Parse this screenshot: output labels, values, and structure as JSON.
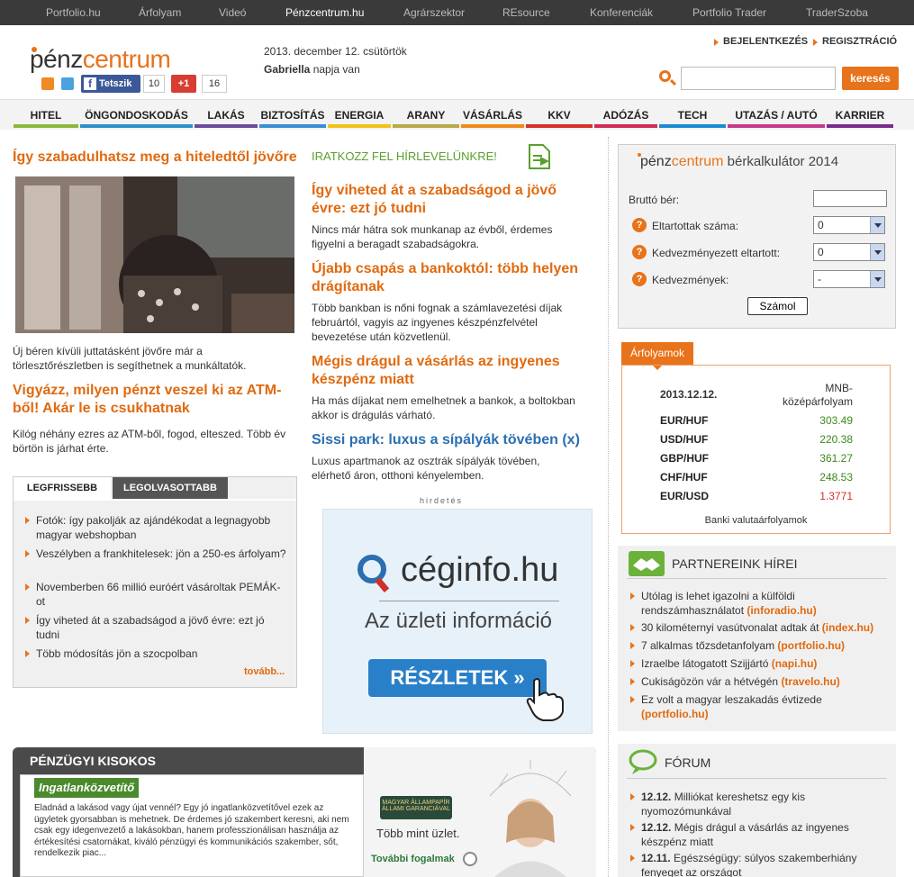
{
  "topnav": [
    "Portfolio.hu",
    "Árfolyam",
    "Videó",
    "Pénzcentrum.hu",
    "Agrárszektor",
    "REsource",
    "Konferenciák",
    "Portfolio Trader",
    "TraderSzoba"
  ],
  "header": {
    "logo_part1": "pénz",
    "logo_part2": "centrum",
    "fb_label": "Tetszik",
    "fb_count": "10",
    "gplus_label": "+1",
    "gplus_count": "16",
    "date": "2013. december 12. csütörtök",
    "nameday_name": "Gabriella",
    "nameday_suffix": " napja van",
    "login": "BEJELENTKEZÉS",
    "register": "REGISZTRÁCIÓ",
    "search_button": "keresés"
  },
  "colors": {
    "accent": "#e8731b"
  },
  "mainnav": [
    {
      "label": "HITEL",
      "color": "#8cb83a"
    },
    {
      "label": "ÖNGONDOSKODÁS",
      "color": "#2e8fc9"
    },
    {
      "label": "LAKÁS",
      "color": "#6c4a9c"
    },
    {
      "label": "BIZTOSÍTÁS",
      "color": "#3a8ed6"
    },
    {
      "label": "ENERGIA",
      "color": "#f3c21a"
    },
    {
      "label": "ARANY",
      "color": "#b9a84a"
    },
    {
      "label": "VÁSÁRLÁS",
      "color": "#ef8a1a"
    },
    {
      "label": "KKV",
      "color": "#d6312a"
    },
    {
      "label": "ADÓZÁS",
      "color": "#d02a5a"
    },
    {
      "label": "TECH",
      "color": "#1a8ad0"
    },
    {
      "label": "UTAZÁS / AUTÓ",
      "color": "#c43a8c"
    },
    {
      "label": "KARRIER",
      "color": "#7a2a8c"
    }
  ],
  "lead": {
    "title": "Így szabadulhatsz meg a hiteledtől jövőre",
    "text": "Új béren kívüli juttatásként jövőre már a törlesztőrészletben is segíthetnek a munkáltatók."
  },
  "article2": {
    "title": "Vigyázz, milyen pénzt veszel ki az ATM-ből! Akár le is csukhatnak",
    "text": "Kilóg néhány ezres az ATM-ből, fogod, elteszed. Több év börtön is járhat érte."
  },
  "tabs": {
    "tab1": "LEGFRISSEBB",
    "tab2": "LEGOLVASOTTABB",
    "items": [
      "Fotók: így pakolják az ajándékodat a legnagyobb magyar webshopban",
      "Veszélyben a frankhitelesek: jön a 250-es árfolyam?",
      "Novemberben 66 millió euróért vásároltak PEMÁK-ot",
      "Így viheted át a szabadságod a jövő évre: ezt jó tudni",
      "Több módosítás jön a szocpolban"
    ],
    "more": "tovább..."
  },
  "middle": {
    "newsletter": "IRATKOZZ FEL HÍRLEVELÜNKRE!",
    "articles": [
      {
        "title": "Így viheted át a szabadságod a jövő évre: ezt jó tudni",
        "text": "Nincs már hátra sok munkanap az évből, érdemes figyelni a beragadt szabadságokra."
      },
      {
        "title": "Újabb csapás a bankoktól: több helyen drágítanak",
        "text": "Több bankban is nőni fognak a számlavezetési díjak februártól, vagyis az ingyenes készpénzfelvétel bevezetése után közvetlenül."
      },
      {
        "title": "Mégis drágul a vásárlás az ingyenes készpénz miatt",
        "text": "Ha más díjakat nem emelhetnek a bankok, a boltokban akkor is drágulás várható."
      },
      {
        "title": "Sissi park: luxus a sípályák tövében (x)",
        "text": "Luxus apartmanok az osztrák sípályák tövében, elérhető áron, otthoni kényelemben."
      }
    ],
    "ad_label": "hirdetés",
    "ad_brand": "céginfo.hu",
    "ad_tagline": "Az üzleti információ",
    "ad_button": "RÉSZLETEK »"
  },
  "kisokos": {
    "title": "PÉNZÜGYI KISOKOS",
    "subtitle": "Ingatlanközvetítő",
    "text": "Eladnád a lakásod vagy újat vennél? Egy jó ingatlanközvetítővel ezek az ügyletek gyorsabban is mehetnek. De érdemes jó szakembert keresni, aki nem csak egy idegenvezető a lakásokban, hanem professzionálisan használja az értékesítési csatornákat, kiváló pénzügyi és kommunikációs szakember, sőt, rendelkezik piac...",
    "badge": "MAGYAR ÁLLAMPAPÍR",
    "badge_sub": "ÁLLAMI GARANCIÁVAL",
    "slogan": "Több mint üzlet.",
    "more": "További fogalmak"
  },
  "calc": {
    "logo_part1": "pénz",
    "logo_part2": "centrum",
    "title": " bérkalkulátor 2014",
    "brutto_label": "Bruttó bér:",
    "rows": [
      {
        "label": "Eltartottak száma:",
        "value": "0"
      },
      {
        "label": "Kedvezményezett eltartott:",
        "value": "0"
      },
      {
        "label": "Kedvezmények:",
        "value": "-"
      }
    ],
    "button": "Számol"
  },
  "fx": {
    "tab": "Árfolyamok",
    "date": "2013.12.12.",
    "header1": "MNB-",
    "header2": "középárfolyam",
    "rows": [
      {
        "pair": "EUR/HUF",
        "value": "303.49",
        "color": "#3a8a1a"
      },
      {
        "pair": "USD/HUF",
        "value": "220.38",
        "color": "#3a8a1a"
      },
      {
        "pair": "GBP/HUF",
        "value": "361.27",
        "color": "#3a8a1a"
      },
      {
        "pair": "CHF/HUF",
        "value": "248.53",
        "color": "#3a8a1a"
      },
      {
        "pair": "EUR/USD",
        "value": "1.3771",
        "color": "#d0302a"
      }
    ],
    "footer": "Banki valutaárfolyamok"
  },
  "partners": {
    "title": "PARTNEREINK HÍREI",
    "items": [
      {
        "text": "Utólag is lehet igazolni a külföldi rendszámhasználatot ",
        "src": "(inforadio.hu)"
      },
      {
        "text": "30 kilométernyi vasútvonalat adtak át ",
        "src": "(index.hu)"
      },
      {
        "text": "7 alkalmas tőzsdetanfolyam ",
        "src": "(portfolio.hu)"
      },
      {
        "text": "Izraelbe látogatott Szijjártó ",
        "src": "(napi.hu)"
      },
      {
        "text": "Cukiságözön vár a hétvégén ",
        "src": "(travelo.hu)"
      },
      {
        "text": "Ez volt a magyar leszakadás évtizede ",
        "src": "(portfolio.hu)"
      }
    ]
  },
  "forum": {
    "title": "FÓRUM",
    "items": [
      {
        "date": "12.12.",
        "text": " Milliókat kereshetsz egy kis nyomozómunkával"
      },
      {
        "date": "12.12.",
        "text": " Mégis drágul a vásárlás az ingyenes készpénz miatt"
      },
      {
        "date": "12.11.",
        "text": " Egészségügy: súlyos szakemberhiány fenyeget az országot"
      }
    ]
  }
}
